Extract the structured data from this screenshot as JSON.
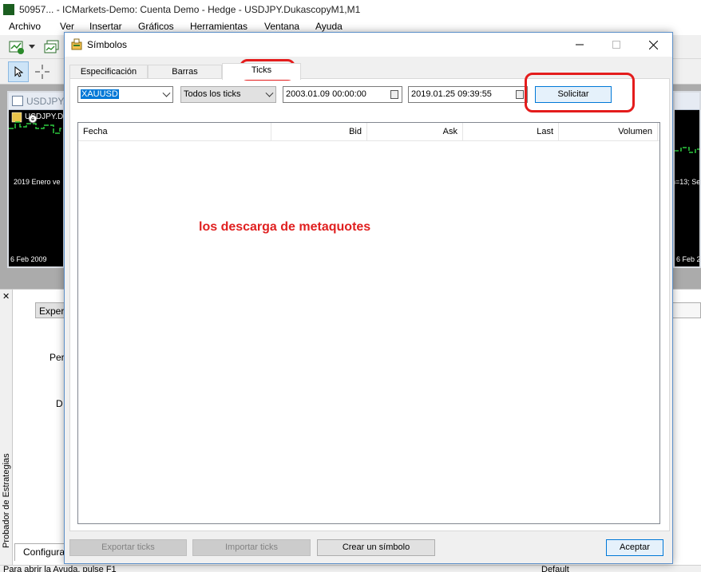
{
  "app": {
    "title": "50957... - ICMarkets-Demo: Cuenta Demo - Hedge - USDJPY.DukascopyM1,M1",
    "menu": [
      "Archivo",
      "Ver",
      "Insertar",
      "Gráficos",
      "Herramientas",
      "Ventana",
      "Ayuda"
    ]
  },
  "charts": {
    "left": {
      "title": "USDJPY.D",
      "symbol": "USDJPY.D",
      "info": "2019 Enero ve",
      "date": "6 Feb 2009"
    },
    "right": {
      "info": "n=13; Se",
      "date": "6 Feb 20"
    }
  },
  "tester": {
    "side_label": "Probador de Estrategias",
    "expert_label": "Expert",
    "per_label": "Per",
    "d_label": "D",
    "tab_label": "Configura"
  },
  "status": {
    "left": "Para abrir la Ayuda, pulse F1",
    "right": "Default"
  },
  "dialog": {
    "title": "Símbolos",
    "tabs": [
      "Especificación",
      "Barras",
      "Ticks"
    ],
    "selected_tab": "Ticks",
    "symbol_value": "XAUUSD",
    "tick_type_value": "Todos los ticks",
    "date_from": "2003.01.09 00:00:00",
    "date_to": "2019.01.25 09:39:55",
    "request_button": "Solicitar",
    "columns": [
      "Fecha",
      "Bid",
      "Ask",
      "Last",
      "Volumen"
    ],
    "buttons": {
      "export": "Exportar ticks",
      "import": "Importar ticks",
      "create": "Crear un símbolo",
      "accept": "Aceptar"
    }
  },
  "annotation": "los descarga de metaquotes",
  "colors": {
    "annotation": "#e02020",
    "highlight": "#e41c1c",
    "chart_line": "#2ecc40",
    "selection": "#0078d7"
  }
}
